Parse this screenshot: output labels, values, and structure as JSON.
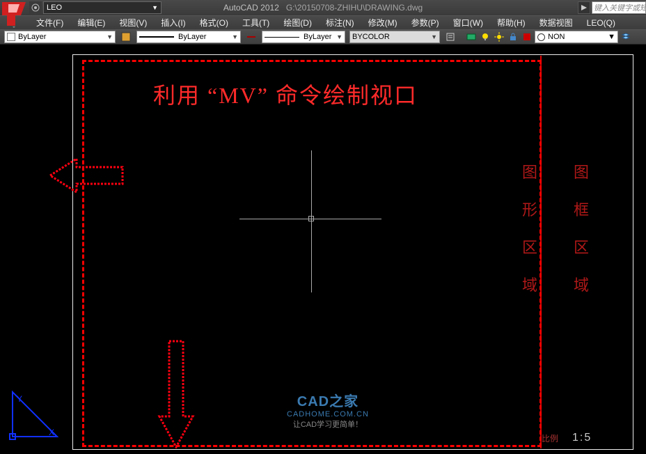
{
  "title": {
    "app": "AutoCAD 2012",
    "path": "G:\\20150708-ZHIHU\\DRAWING.dwg"
  },
  "workspace": {
    "current": "LEO"
  },
  "keyword_box": {
    "placeholder": "键入关键字或短"
  },
  "menus": {
    "file": "文件(F)",
    "edit": "编辑(E)",
    "view": "视图(V)",
    "insert": "插入(I)",
    "format": "格式(O)",
    "tools": "工具(T)",
    "draw": "绘图(D)",
    "dimension": "标注(N)",
    "modify": "修改(M)",
    "param": "参数(P)",
    "window": "窗口(W)",
    "help": "帮助(H)",
    "dataview": "数据视图",
    "leo": "LEO(Q)"
  },
  "props": {
    "color": "ByLayer",
    "linetype": "ByLayer",
    "lineweight": "ByLayer",
    "plotstyle": "BYCOLOR",
    "non": "NON"
  },
  "canvas": {
    "title": "利用 “MV” 命令绘制视口",
    "vleft": [
      "图",
      "形",
      "区",
      "域"
    ],
    "vright": [
      "图",
      "框",
      "区",
      "域"
    ],
    "scale_label": "比例",
    "scale_value": "1:5"
  },
  "watermark": {
    "l1": "CAD之家",
    "l2": "CADHOME.COM.CN",
    "l3": "让CAD学习更简单！"
  }
}
